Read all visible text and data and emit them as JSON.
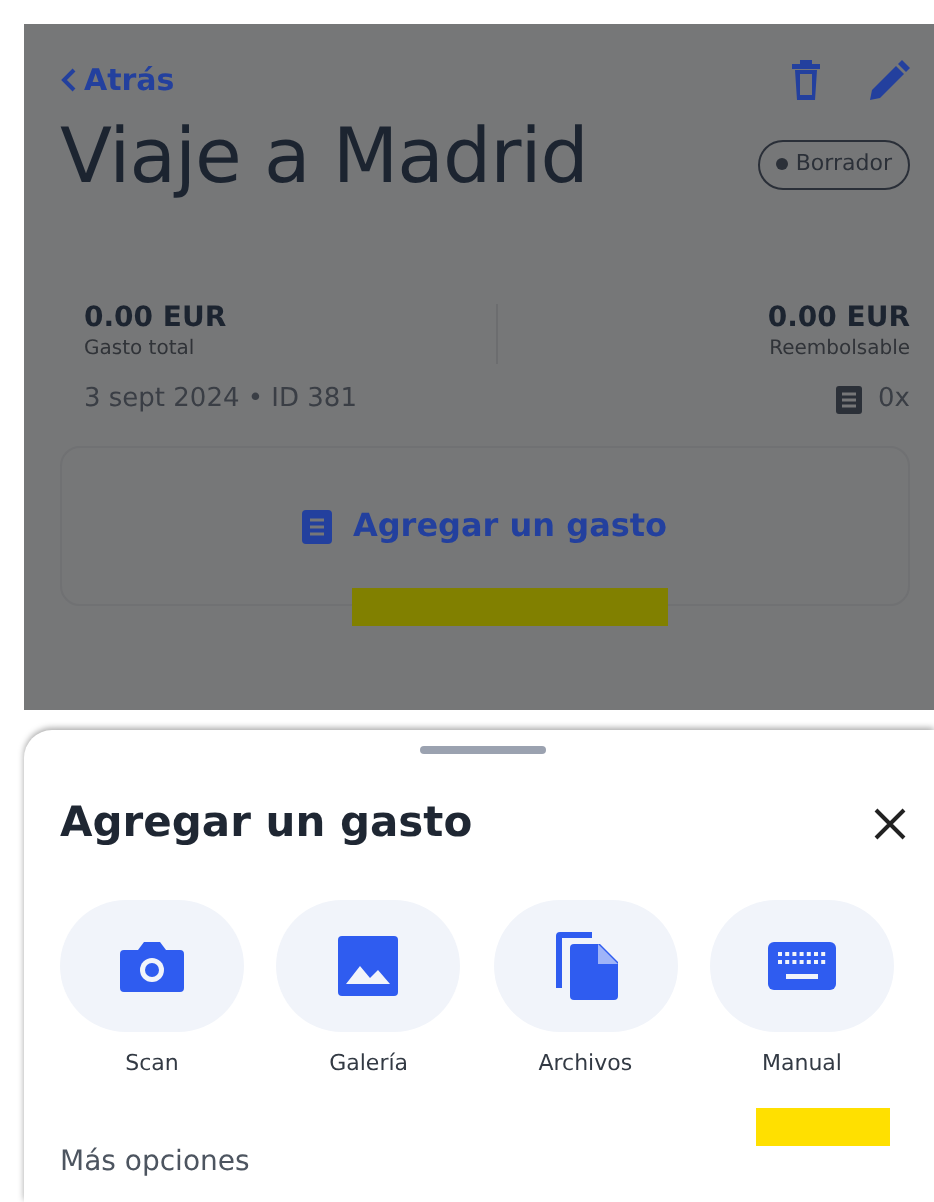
{
  "header": {
    "back_label": "Atrás",
    "title": "Viaje a Madrid",
    "status": "Borrador"
  },
  "summary": {
    "stats": [
      {
        "amount": "0.00 EUR",
        "label": "Gasto total"
      },
      {
        "amount": "0.00 EUR",
        "label": "Reembolsable"
      }
    ],
    "date_line": "3 sept 2024 • ID 381",
    "receipts": "0x"
  },
  "add_expense_button": "Agregar un gasto",
  "sheet": {
    "title": "Agregar un gasto",
    "options": [
      {
        "kind": "camera",
        "label": "Scan",
        "highlighted": false
      },
      {
        "kind": "gallery",
        "label": "Galería",
        "highlighted": false
      },
      {
        "kind": "files",
        "label": "Archivos",
        "highlighted": false
      },
      {
        "kind": "keyboard",
        "label": "Manual",
        "highlighted": true
      }
    ],
    "more_label": "Más opciones"
  }
}
